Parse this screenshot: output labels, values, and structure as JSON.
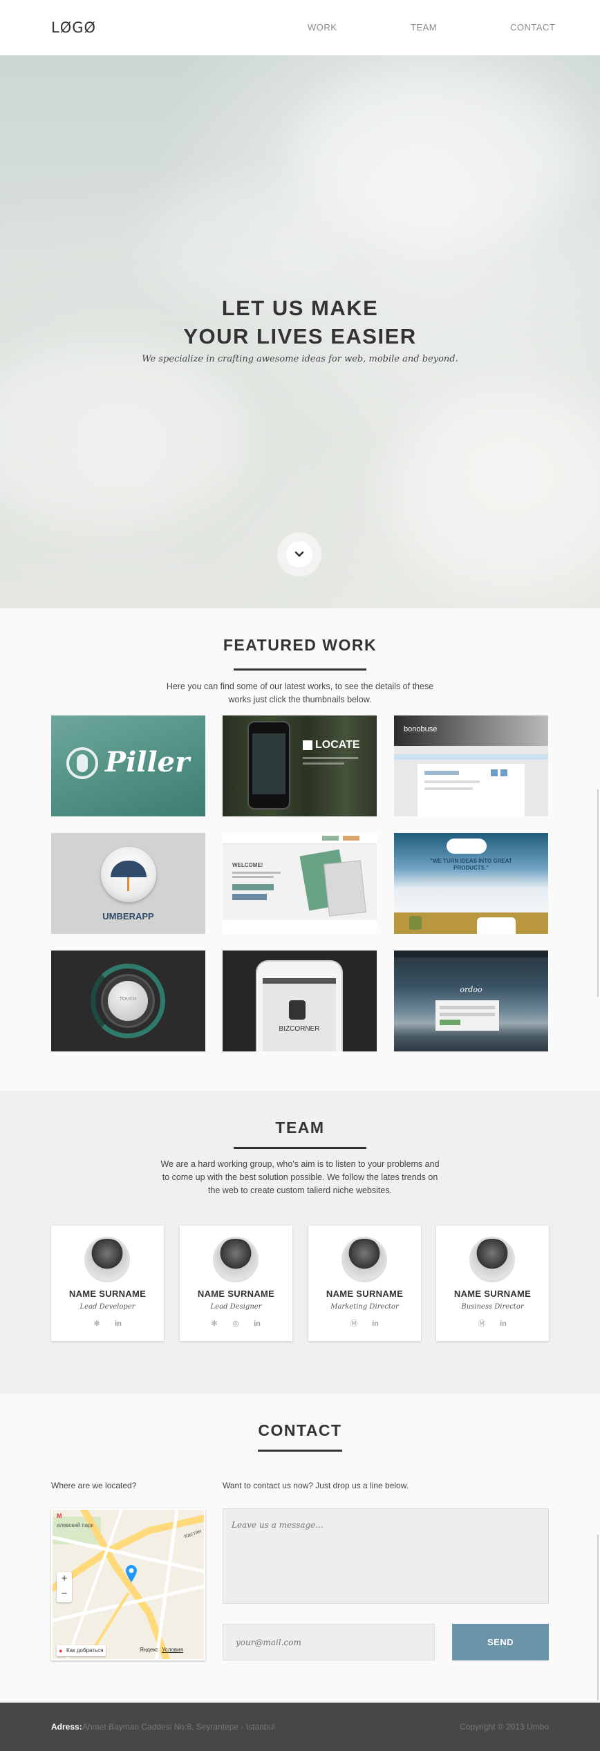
{
  "header": {
    "logo": "LØGØ",
    "nav": [
      {
        "label": "WORK"
      },
      {
        "label": "TEAM"
      },
      {
        "label": "CONTACT"
      }
    ]
  },
  "hero": {
    "title_line1": "LET US MAKE",
    "title_line2": "YOUR LIVES EASIER",
    "subtitle": "We specialize in crafting awesome ideas for web, mobile and beyond.",
    "scroll_icon": "chevron-down-icon"
  },
  "work": {
    "title": "FEATURED WORK",
    "intro_line1": "Here you can find some of our latest works, to see the details of these",
    "intro_line2": "works just click the thumbnails below.",
    "items": [
      {
        "text": "Piller"
      },
      {
        "text": "LOCATE"
      },
      {
        "text": "bonobuse"
      },
      {
        "text": "UMBERAPP"
      },
      {
        "text": "WELCOME!"
      },
      {
        "text": "\"WE TURN IDEAS INTO GREAT PRODUCTS.\""
      },
      {
        "text": "TOUCH"
      },
      {
        "text": "BIZCORNER"
      },
      {
        "text": "ordoo"
      }
    ]
  },
  "team": {
    "title": "TEAM",
    "intro_line1": "We are a hard working group, who's aim is to listen to your problems and",
    "intro_line2": "to come up with the best solution possible. We follow the lates trends on",
    "intro_line3": "the web to create custom talierd niche websites.",
    "members": [
      {
        "name": "NAME SURNAME",
        "role": "Lead Developer",
        "social": [
          "twitter-icon",
          "linkedin-icon"
        ]
      },
      {
        "name": "NAME SURNAME",
        "role": "Lead Designer",
        "social": [
          "twitter-icon",
          "dribbble-icon",
          "linkedin-icon"
        ]
      },
      {
        "name": "NAME SURNAME",
        "role": "Marketing Director",
        "social": [
          "skype-icon",
          "linkedin-icon"
        ]
      },
      {
        "name": "NAME SURNAME",
        "role": "Business Director",
        "social": [
          "skype-icon",
          "linkedin-icon"
        ]
      }
    ]
  },
  "contact": {
    "title": "CONTACT",
    "location_label": "Where are we located?",
    "form_label": "Want to contact us now? Just drop us a line below.",
    "message_placeholder": "Leave us a message...",
    "email_placeholder": "your@mail.com",
    "send_label": "SEND",
    "map": {
      "park_label": "илевский парк",
      "street_label": "Кастан",
      "zoom_in": "+",
      "zoom_out": "−",
      "route_label": "Как добраться",
      "brand_label": "Яндекс",
      "terms_label": "Условия"
    }
  },
  "footer": {
    "address_label": "Adress:",
    "address": "Ahmet Bayman Caddesi No:8, Seyrantepe - Istanbul",
    "copyright": "Copyright © 2013 Umbo"
  },
  "colors": {
    "accent": "#6a95a9",
    "footer_bg": "#474747",
    "text_dark": "#333333"
  }
}
